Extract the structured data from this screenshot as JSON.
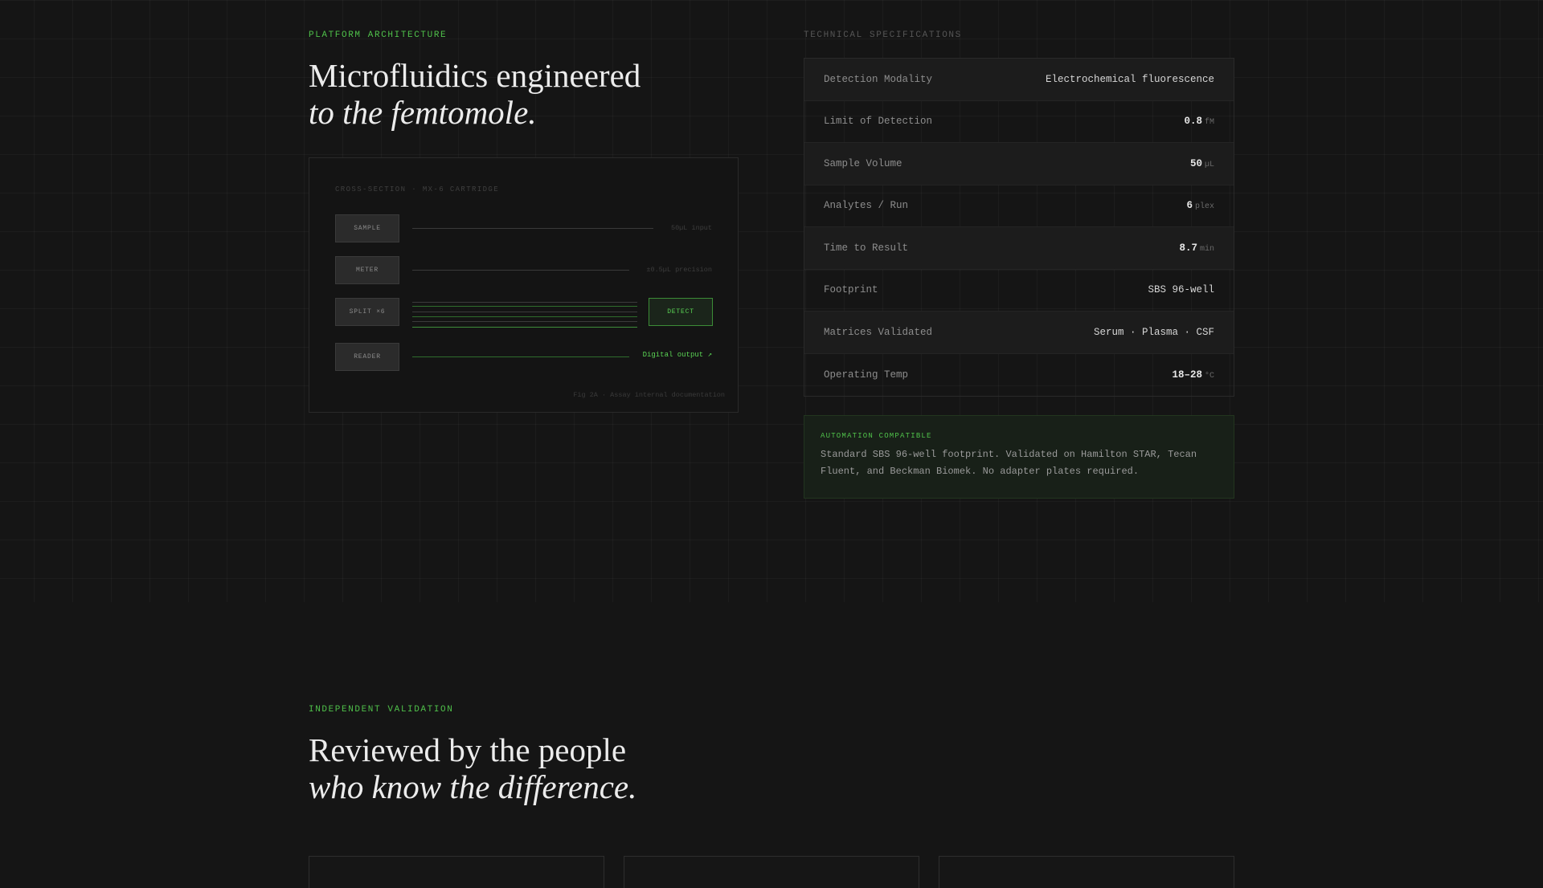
{
  "architecture": {
    "eyebrow": "PLATFORM ARCHITECTURE",
    "title_line1": "Microfluidics engineered",
    "title_line2": "to the femtomole.",
    "diagram": {
      "caption": "CROSS-SECTION · MX-6 CARTRIDGE",
      "stages": [
        "SAMPLE",
        "METER",
        "SPLIT ×6",
        "READER"
      ],
      "sample_note": "50µL input",
      "meter_note": "±0.5µL precision",
      "detect_label": "DETECT",
      "output_label": "Digital output ↗",
      "fig_caption": "Fig 2A · Assay internal documentation"
    }
  },
  "specs": {
    "eyebrow": "TECHNICAL SPECIFICATIONS",
    "rows": [
      {
        "key": "Detection Modality",
        "value": "Electrochemical fluorescence",
        "unit": ""
      },
      {
        "key": "Limit of Detection",
        "value": "0.8",
        "unit": "fM"
      },
      {
        "key": "Sample Volume",
        "value": "50",
        "unit": "µL"
      },
      {
        "key": "Analytes / Run",
        "value": "6",
        "unit": "plex"
      },
      {
        "key": "Time to Result",
        "value": "8.7",
        "unit": "min"
      },
      {
        "key": "Footprint",
        "value": "SBS 96-well",
        "unit": ""
      },
      {
        "key": "Matrices Validated",
        "value": "Serum · Plasma · CSF",
        "unit": ""
      },
      {
        "key": "Operating Temp",
        "value": "18–28",
        "unit": "°C"
      }
    ]
  },
  "automation": {
    "tag": "AUTOMATION COMPATIBLE",
    "text": "Standard SBS 96-well footprint. Validated on Hamilton STAR, Tecan Fluent, and Beckman Biomek. No adapter plates required."
  },
  "validation": {
    "eyebrow": "INDEPENDENT VALIDATION",
    "title_line1": "Reviewed by the people",
    "title_line2": "who know the difference."
  },
  "colors": {
    "background": "#151515",
    "accent": "#4fc04a"
  }
}
